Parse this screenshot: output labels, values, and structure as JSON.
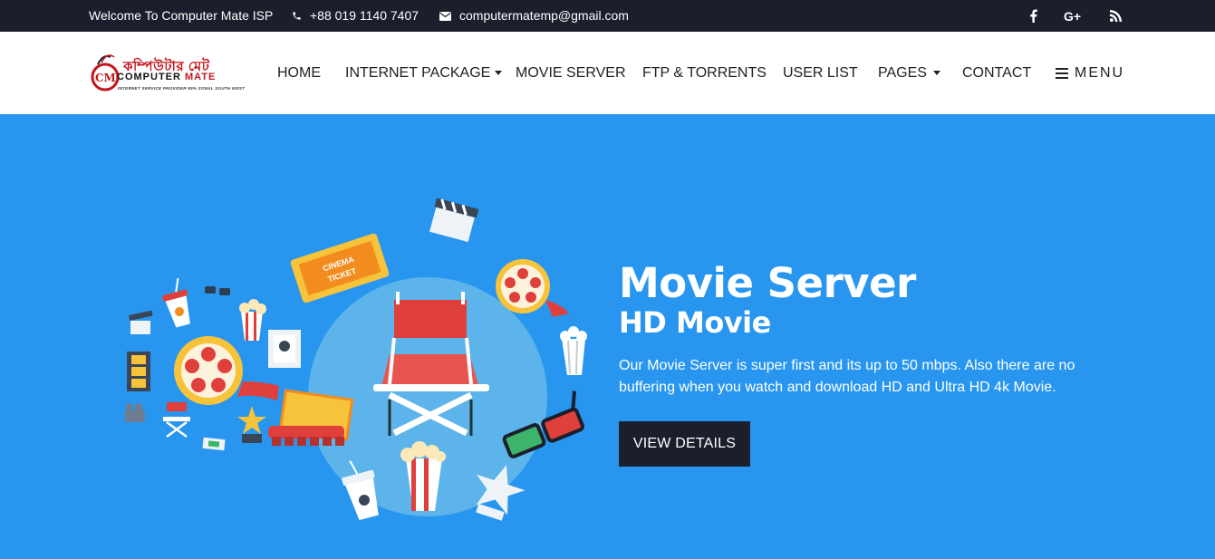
{
  "topbar": {
    "welcome": "Welcome To Computer Mate ISP",
    "phone": "+88 019 1140 7407",
    "email": "computermatemp@gmail.com",
    "social": [
      {
        "icon": "facebook-icon",
        "glyph": "f"
      },
      {
        "icon": "google-plus-icon",
        "glyph": "G+"
      },
      {
        "icon": "rss-icon",
        "glyph": "rss"
      }
    ]
  },
  "logo": {
    "bengali": "কম্পিউটার মেট",
    "english_a": "COMPUTER",
    "english_b": "MATE",
    "tagline": "INTERNET SERVICE PROVIDER 89% ZONAL SOUTH WEST"
  },
  "nav": {
    "home": "HOME",
    "internet_package": "INTERNET PACKAGE",
    "movie_server": "MOVIE SERVER",
    "ftp_torrents": "FTP & TORRENTS",
    "user_list": "USER LIST",
    "pages": "PAGES",
    "contact": "CONTACT",
    "menu": "MENU"
  },
  "hero": {
    "title": "Movie Server",
    "subtitle": "HD Movie",
    "description": "Our Movie Server is super first and its up to 50 mbps. Also there are no buffering when you watch and download HD and Ultra HD 4k Movie.",
    "button": "VIEW DETAILS",
    "ticket_line1": "CINEMA",
    "ticket_line2": "TICKET"
  },
  "colors": {
    "topbar_bg": "#1b1f2c",
    "hero_bg": "#2896ef",
    "button_bg": "#1b1f2c",
    "accent_red": "#c4161c"
  }
}
